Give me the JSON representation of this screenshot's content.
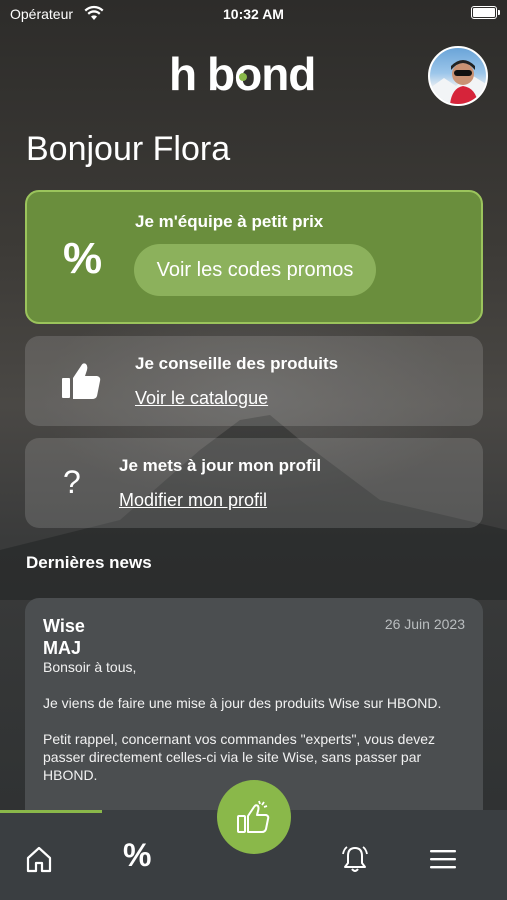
{
  "status_bar": {
    "carrier": "Opérateur",
    "time": "10:32 AM"
  },
  "header": {
    "logo_text": "h bond",
    "avatar": "user-avatar"
  },
  "greeting": "Bonjour Flora",
  "cards": {
    "promo": {
      "icon": "percent-icon",
      "title": "Je m'équipe à petit prix",
      "button": "Voir les codes promos"
    },
    "catalog": {
      "icon": "thumbs-up-icon",
      "title": "Je conseille des produits",
      "link": "Voir le catalogue"
    },
    "profile": {
      "icon": "question-icon",
      "title": "Je mets à jour mon profil",
      "link": "Modifier mon profil"
    }
  },
  "news": {
    "heading": "Dernières news",
    "items": [
      {
        "brand": "Wise",
        "subject": "MAJ",
        "date": "26 Juin 2023",
        "paragraphs": [
          "Bonsoir à tous,",
          "Je viens de faire une mise à jour des produits Wise sur HBOND.",
          "Petit rappel, concernant vos commandes \"experts\", vous devez passer directement celles-ci via le site Wise, sans passer par HBOND."
        ]
      }
    ]
  },
  "tab_bar": {
    "items": [
      {
        "name": "home",
        "icon": "home-icon"
      },
      {
        "name": "promos",
        "icon": "percent-icon"
      },
      {
        "name": "recommend",
        "icon": "thumbs-up-icon"
      },
      {
        "name": "notifications",
        "icon": "bell-icon"
      },
      {
        "name": "menu",
        "icon": "menu-icon"
      }
    ],
    "active_index": 0
  },
  "colors": {
    "accent": "#8ab84a",
    "promo_card": "#6a8e3d",
    "tab_bar": "#3a3e41"
  }
}
